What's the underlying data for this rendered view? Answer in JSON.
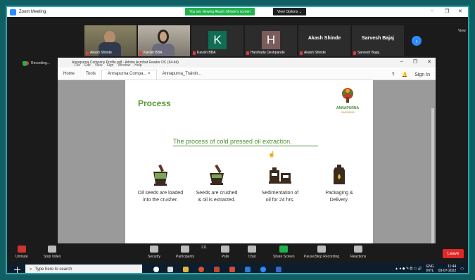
{
  "zoom": {
    "title": "Zoom Meeting",
    "share_banner": "You are viewing Akash Shinde's screen",
    "view_options": "View Options ⌄",
    "view_button": "View",
    "recording": "Recording..."
  },
  "participants": [
    {
      "name": "Akash Shinde",
      "type": "video",
      "color": "#6f6a52"
    },
    {
      "name": "Kavish BBA",
      "type": "video",
      "color": "#7d7566"
    },
    {
      "name": "Kavish BBA",
      "type": "letter",
      "letter": "K",
      "color": "#0e6d52"
    },
    {
      "name": "Harshada Deshpande",
      "type": "letter",
      "letter": "H",
      "color": "#7a5c5a"
    },
    {
      "name": "Akash Shinde",
      "type": "name",
      "big": "Akash Shinde"
    },
    {
      "name": "Sarvesh Bajaj",
      "type": "name",
      "big": "Sarvesh Bajaj"
    }
  ],
  "acrobat": {
    "title": "Annapurna Company Profile.pdf - Adobe Acrobat Reader DC (64-bit)",
    "menu": [
      "File",
      "Edit",
      "View",
      "Sign",
      "Window",
      "Help"
    ],
    "tabs": [
      "Home",
      "Tools",
      "Annapurna Compa... ×",
      "Annapurna_Trainin..."
    ],
    "sign_in": "Sign In"
  },
  "slide": {
    "title": "Process",
    "subtitle": "The process of cold pressed oil extraction.",
    "logo_name": "ANNAPURNA",
    "logo_tag": "GARDENS",
    "steps": [
      {
        "caption1": "Oil seeds are loaded",
        "caption2": "into the crusher."
      },
      {
        "caption1": "Seeds are crushed",
        "caption2": "& oil is extracted."
      },
      {
        "caption1": "Sedimentation of",
        "caption2": "oil for 24 hrs."
      },
      {
        "caption1": "Packaging &",
        "caption2": "Delivery."
      }
    ]
  },
  "toolbar": {
    "unmute": "Unmute",
    "stop_video": "Stop Video",
    "security": "Security",
    "participants": "Participants",
    "participants_count": "211",
    "polls": "Polls",
    "chat": "Chat",
    "share_screen": "Share Screen",
    "recording": "Pause/Stop Recording",
    "reactions": "Reactions",
    "leave": "Leave"
  },
  "taskbar": {
    "search_placeholder": "Type here to search",
    "lang": "ENG",
    "region": "INTL",
    "time": "11:44",
    "date": "03-07-2022"
  }
}
